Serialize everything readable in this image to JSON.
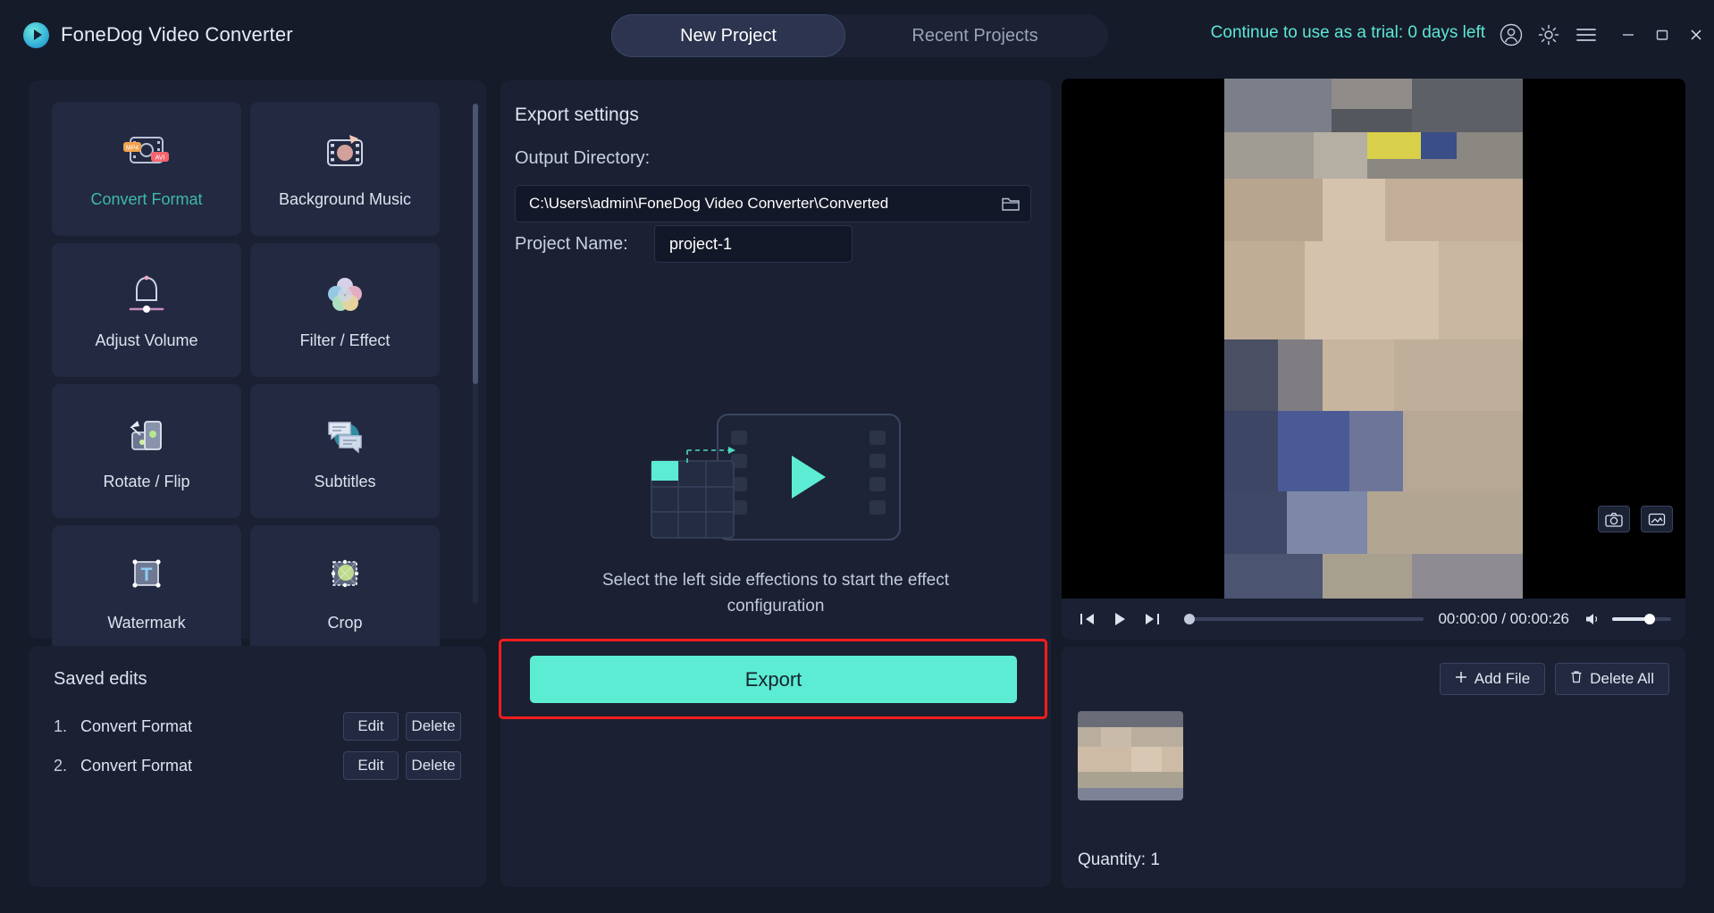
{
  "app": {
    "title": "FoneDog Video Converter",
    "logo_icon": "play-circle-icon"
  },
  "header": {
    "tabs": [
      {
        "label": "New Project",
        "active": true
      },
      {
        "label": "Recent Projects",
        "active": false
      }
    ],
    "trial_text": "Continue to use as a trial: 0 days left",
    "trial_color": "#5ce8d5",
    "icons": [
      "account-icon",
      "gear-icon",
      "hamburger-menu-icon"
    ],
    "window_controls": [
      "minimize-icon",
      "maximize-icon",
      "close-icon"
    ]
  },
  "sidebar": {
    "tools": [
      {
        "label": "Convert Format",
        "icon": "convert-format-icon",
        "selected": true
      },
      {
        "label": "Background Music",
        "icon": "background-music-icon",
        "selected": false
      },
      {
        "label": "Adjust Volume",
        "icon": "adjust-volume-icon",
        "selected": false
      },
      {
        "label": "Filter / Effect",
        "icon": "filter-effect-icon",
        "selected": false
      },
      {
        "label": "Rotate / Flip",
        "icon": "rotate-flip-icon",
        "selected": false
      },
      {
        "label": "Subtitles",
        "icon": "subtitles-icon",
        "selected": false
      },
      {
        "label": "Watermark",
        "icon": "watermark-icon",
        "selected": false
      },
      {
        "label": "Crop",
        "icon": "crop-icon",
        "selected": false
      }
    ]
  },
  "saved_edits": {
    "title": "Saved edits",
    "items": [
      {
        "index": "1.",
        "name": "Convert Format",
        "edit_label": "Edit",
        "delete_label": "Delete"
      },
      {
        "index": "2.",
        "name": "Convert Format",
        "edit_label": "Edit",
        "delete_label": "Delete"
      }
    ]
  },
  "export_settings": {
    "title": "Export settings",
    "output_directory_label": "Output Directory:",
    "output_directory_value": "C:\\Users\\admin\\FoneDog Video Converter\\Converted",
    "browse_icon": "folder-icon",
    "project_name_label": "Project Name:",
    "project_name_value": "project-1",
    "placeholder_caption": "Select the left side effections to start the effect configuration",
    "placeholder_icon": "video-effect-placeholder-icon",
    "export_label": "Export",
    "export_button_color": "#5cecd4",
    "highlight_color": "#fa1d1d"
  },
  "preview": {
    "controls": {
      "prev_icon": "skip-previous-icon",
      "play_icon": "play-icon",
      "next_icon": "skip-next-icon",
      "current_time": "00:00:00",
      "separator": "/",
      "total_time": "00:00:26",
      "timecode": "00:00:00 / 00:00:26",
      "volume_icon": "volume-icon"
    },
    "overlay_buttons": [
      {
        "icon": "camera-snapshot-icon"
      },
      {
        "icon": "gif-capture-icon"
      }
    ]
  },
  "file_list": {
    "add_file_label": "Add File",
    "add_file_icon": "plus-icon",
    "delete_all_label": "Delete All",
    "delete_all_icon": "trash-icon",
    "quantity_label": "Quantity: 1",
    "thumbnail_icon": "video-thumbnail"
  }
}
